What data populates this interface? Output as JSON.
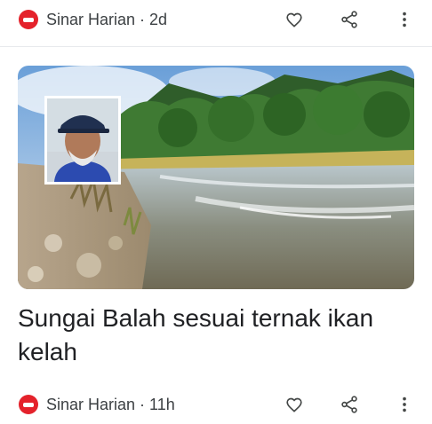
{
  "cards": [
    {
      "source": "Sinar Harian",
      "separator": "·",
      "age": "2d",
      "source_meta": "Sinar Harian · 2d"
    },
    {
      "headline": "Sungai Balah sesuai ternak ikan kelah",
      "source": "Sinar Harian",
      "age": "11h",
      "source_meta": "Sinar Harian · 11h"
    }
  ],
  "icons": {
    "source_logo": "sinar-harian-logo-icon",
    "save": "heart-icon",
    "share": "share-icon",
    "more": "more-vert-icon"
  },
  "colors": {
    "brand": "#e4222b",
    "text": "#202124",
    "meta": "#3c4043"
  }
}
